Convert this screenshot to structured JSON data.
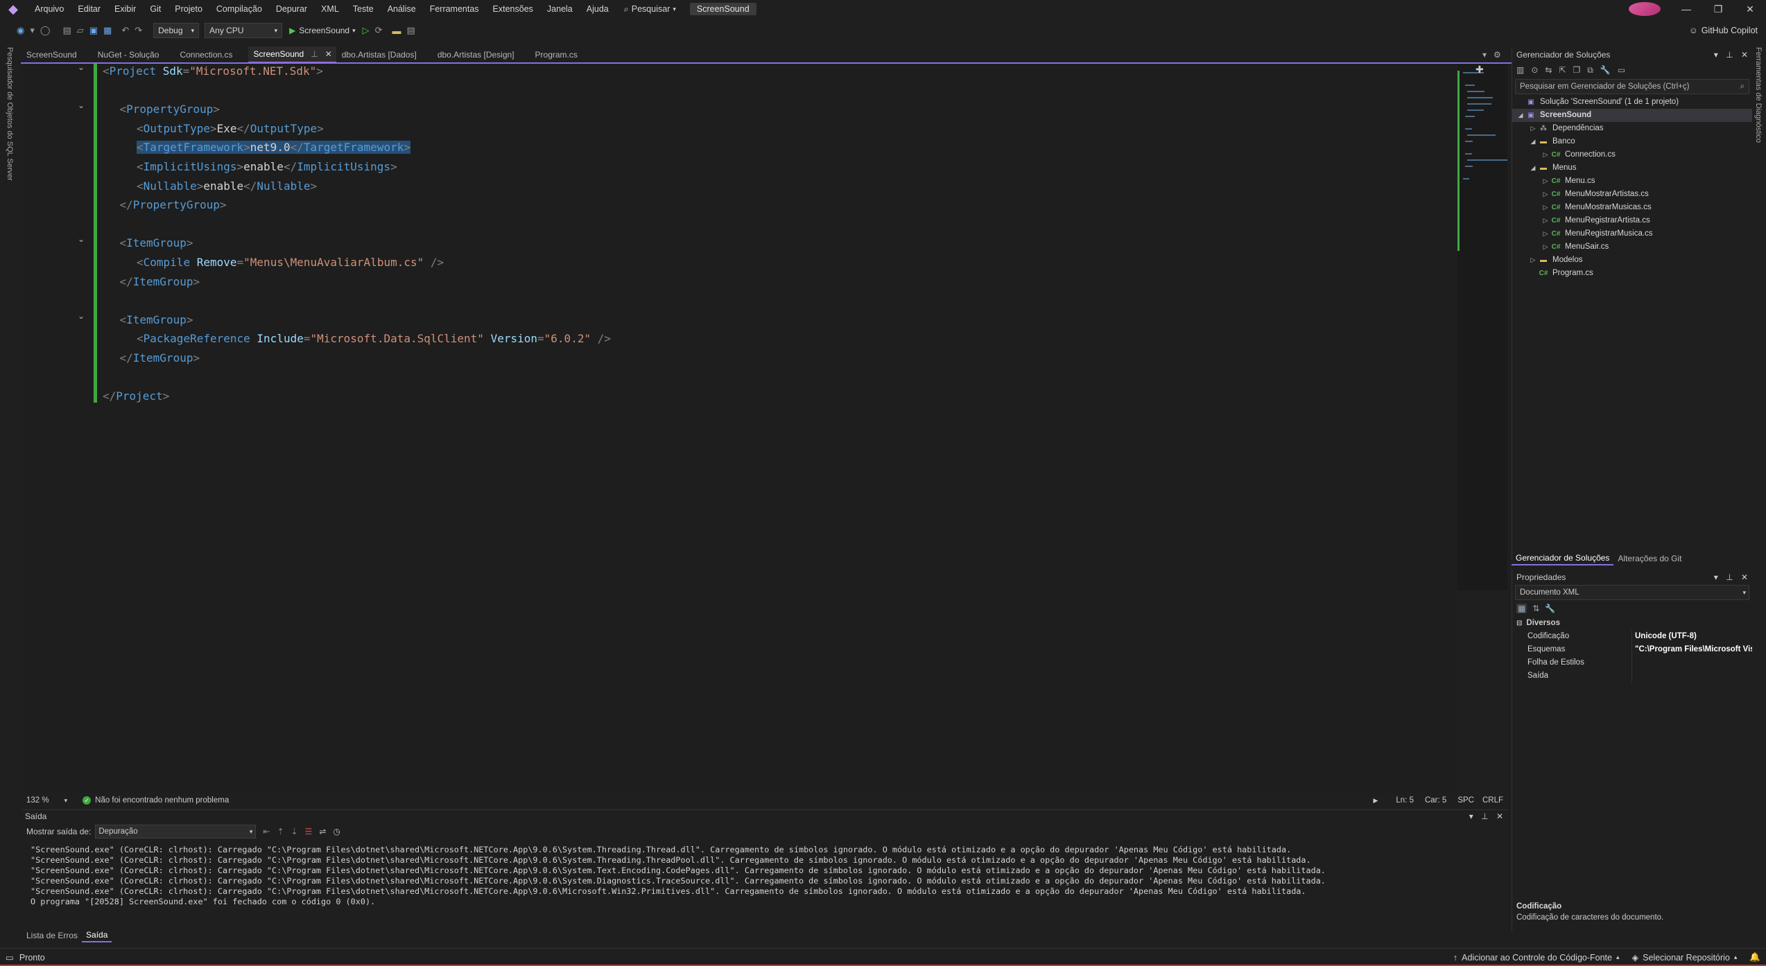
{
  "menubar": {
    "items": [
      "Arquivo",
      "Editar",
      "Exibir",
      "Git",
      "Projeto",
      "Compilação",
      "Depurar",
      "XML",
      "Teste",
      "Análise",
      "Ferramentas",
      "Extensões",
      "Janela",
      "Ajuda"
    ],
    "search_label": "Pesquisar",
    "project_badge": "ScreenSound"
  },
  "toolbar": {
    "config": "Debug",
    "platform": "Any CPU",
    "run_target": "ScreenSound",
    "copilot_label": "GitHub Copilot"
  },
  "side_labels": {
    "left": "Pesquisador de Objetos do SQL Server",
    "right": "Ferramentas de Diagnóstico"
  },
  "tabs": [
    {
      "label": "ScreenSound",
      "active": false
    },
    {
      "label": "NuGet - Solução",
      "active": false
    },
    {
      "label": "Connection.cs",
      "active": false
    },
    {
      "label": "ScreenSound",
      "active": true
    },
    {
      "label": "dbo.Artistas [Dados]",
      "active": false
    },
    {
      "label": "dbo.Artistas [Design]",
      "active": false
    },
    {
      "label": "Program.cs",
      "active": false
    }
  ],
  "editor": {
    "lines": [
      {
        "indent": 0,
        "fold": true,
        "tokens": [
          [
            "b",
            "<"
          ],
          [
            "n",
            "Project"
          ],
          [
            "x",
            " "
          ],
          [
            "a",
            "Sdk"
          ],
          [
            "b",
            "="
          ],
          [
            "s",
            "\"Microsoft.NET.Sdk\""
          ],
          [
            "b",
            ">"
          ]
        ]
      },
      {
        "indent": 0,
        "fold": false,
        "tokens": []
      },
      {
        "indent": 1,
        "fold": true,
        "tokens": [
          [
            "b",
            "<"
          ],
          [
            "n",
            "PropertyGroup"
          ],
          [
            "b",
            ">"
          ]
        ]
      },
      {
        "indent": 2,
        "fold": false,
        "tokens": [
          [
            "b",
            "<"
          ],
          [
            "n",
            "OutputType"
          ],
          [
            "b",
            ">"
          ],
          [
            "x",
            "Exe"
          ],
          [
            "b",
            "</"
          ],
          [
            "n",
            "OutputType"
          ],
          [
            "b",
            ">"
          ]
        ]
      },
      {
        "indent": 2,
        "fold": false,
        "highlight": true,
        "tokens": [
          [
            "b",
            "<"
          ],
          [
            "n",
            "TargetFramework"
          ],
          [
            "b",
            ">"
          ],
          [
            "x",
            "net9.0"
          ],
          [
            "b",
            "</"
          ],
          [
            "n",
            "TargetFramework"
          ],
          [
            "b",
            ">"
          ]
        ]
      },
      {
        "indent": 2,
        "fold": false,
        "tokens": [
          [
            "b",
            "<"
          ],
          [
            "n",
            "ImplicitUsings"
          ],
          [
            "b",
            ">"
          ],
          [
            "x",
            "enable"
          ],
          [
            "b",
            "</"
          ],
          [
            "n",
            "ImplicitUsings"
          ],
          [
            "b",
            ">"
          ]
        ]
      },
      {
        "indent": 2,
        "fold": false,
        "tokens": [
          [
            "b",
            "<"
          ],
          [
            "n",
            "Nullable"
          ],
          [
            "b",
            ">"
          ],
          [
            "x",
            "enable"
          ],
          [
            "b",
            "</"
          ],
          [
            "n",
            "Nullable"
          ],
          [
            "b",
            ">"
          ]
        ]
      },
      {
        "indent": 1,
        "fold": false,
        "tokens": [
          [
            "b",
            "</"
          ],
          [
            "n",
            "PropertyGroup"
          ],
          [
            "b",
            ">"
          ]
        ]
      },
      {
        "indent": 0,
        "fold": false,
        "tokens": []
      },
      {
        "indent": 1,
        "fold": true,
        "tokens": [
          [
            "b",
            "<"
          ],
          [
            "n",
            "ItemGroup"
          ],
          [
            "b",
            ">"
          ]
        ]
      },
      {
        "indent": 2,
        "fold": false,
        "tokens": [
          [
            "b",
            "<"
          ],
          [
            "n",
            "Compile"
          ],
          [
            "x",
            " "
          ],
          [
            "a",
            "Remove"
          ],
          [
            "b",
            "="
          ],
          [
            "s",
            "\"Menus\\MenuAvaliarAlbum.cs\""
          ],
          [
            "x",
            " "
          ],
          [
            "b",
            "/>"
          ]
        ]
      },
      {
        "indent": 1,
        "fold": false,
        "tokens": [
          [
            "b",
            "</"
          ],
          [
            "n",
            "ItemGroup"
          ],
          [
            "b",
            ">"
          ]
        ]
      },
      {
        "indent": 0,
        "fold": false,
        "tokens": []
      },
      {
        "indent": 1,
        "fold": true,
        "tokens": [
          [
            "b",
            "<"
          ],
          [
            "n",
            "ItemGroup"
          ],
          [
            "b",
            ">"
          ]
        ]
      },
      {
        "indent": 2,
        "fold": false,
        "tokens": [
          [
            "b",
            "<"
          ],
          [
            "n",
            "PackageReference"
          ],
          [
            "x",
            " "
          ],
          [
            "a",
            "Include"
          ],
          [
            "b",
            "="
          ],
          [
            "s",
            "\"Microsoft.Data.SqlClient\""
          ],
          [
            "x",
            " "
          ],
          [
            "a",
            "Version"
          ],
          [
            "b",
            "="
          ],
          [
            "s",
            "\"6.0.2\""
          ],
          [
            "x",
            " "
          ],
          [
            "b",
            "/>"
          ]
        ]
      },
      {
        "indent": 1,
        "fold": false,
        "tokens": [
          [
            "b",
            "</"
          ],
          [
            "n",
            "ItemGroup"
          ],
          [
            "b",
            ">"
          ]
        ]
      },
      {
        "indent": 0,
        "fold": false,
        "tokens": []
      },
      {
        "indent": 0,
        "fold": false,
        "tokens": [
          [
            "b",
            "</"
          ],
          [
            "n",
            "Project"
          ],
          [
            "b",
            ">"
          ]
        ]
      }
    ]
  },
  "editor_status": {
    "zoom": "132 %",
    "issues": "Não foi encontrado nenhum problema",
    "line": "Ln: 5",
    "col": "Car: 5",
    "spc": "SPC",
    "eol": "CRLF"
  },
  "solution_explorer": {
    "title": "Gerenciador de Soluções",
    "search_placeholder": "Pesquisar em Gerenciador de Soluções (Ctrl+ç)",
    "tree": [
      {
        "level": 0,
        "exp": "",
        "icon": "solution-icon",
        "glyph": "▣",
        "cls": "sln",
        "label": "Solução 'ScreenSound' (1 de 1 projeto)"
      },
      {
        "level": 0,
        "exp": "◢",
        "icon": "project-icon",
        "glyph": "▣",
        "cls": "sln",
        "label": "ScreenSound",
        "selected": true
      },
      {
        "level": 1,
        "exp": "▷",
        "icon": "dependencies-icon",
        "glyph": "⁂",
        "cls": "dep",
        "label": "Dependências"
      },
      {
        "level": 1,
        "exp": "◢",
        "icon": "folder-icon",
        "glyph": "▬",
        "cls": "folder",
        "label": "Banco"
      },
      {
        "level": 2,
        "exp": "▷",
        "icon": "csharp-file-icon",
        "glyph": "C#",
        "cls": "cs",
        "label": "Connection.cs"
      },
      {
        "level": 1,
        "exp": "◢",
        "icon": "folder-icon",
        "glyph": "▬",
        "cls": "folder",
        "label": "Menus"
      },
      {
        "level": 2,
        "exp": "▷",
        "icon": "csharp-file-icon",
        "glyph": "C#",
        "cls": "cs",
        "label": "Menu.cs"
      },
      {
        "level": 2,
        "exp": "▷",
        "icon": "csharp-file-icon",
        "glyph": "C#",
        "cls": "cs",
        "label": "MenuMostrarArtistas.cs"
      },
      {
        "level": 2,
        "exp": "▷",
        "icon": "csharp-file-icon",
        "glyph": "C#",
        "cls": "cs",
        "label": "MenuMostrarMusicas.cs"
      },
      {
        "level": 2,
        "exp": "▷",
        "icon": "csharp-file-icon",
        "glyph": "C#",
        "cls": "cs",
        "label": "MenuRegistrarArtista.cs"
      },
      {
        "level": 2,
        "exp": "▷",
        "icon": "csharp-file-icon",
        "glyph": "C#",
        "cls": "cs",
        "label": "MenuRegistrarMusica.cs"
      },
      {
        "level": 2,
        "exp": "▷",
        "icon": "csharp-file-icon",
        "glyph": "C#",
        "cls": "cs",
        "label": "MenuSair.cs"
      },
      {
        "level": 1,
        "exp": "▷",
        "icon": "folder-icon",
        "glyph": "▬",
        "cls": "folder",
        "label": "Modelos"
      },
      {
        "level": 1,
        "exp": "",
        "icon": "csharp-file-icon",
        "glyph": "C#",
        "cls": "cs",
        "label": "Program.cs"
      }
    ],
    "bottom_tabs": [
      "Gerenciador de Soluções",
      "Alterações do Git"
    ]
  },
  "properties": {
    "title": "Propriedades",
    "object": "Documento XML",
    "category": "Diversos",
    "rows": [
      {
        "key": "Codificação",
        "value": "Unicode (UTF-8)"
      },
      {
        "key": "Esquemas",
        "value": "\"C:\\Program Files\\Microsoft Vis"
      },
      {
        "key": "Folha de Estilos",
        "value": ""
      },
      {
        "key": "Saída",
        "value": ""
      }
    ],
    "desc_title": "Codificação",
    "desc_text": "Codificação de caracteres do documento."
  },
  "output": {
    "title": "Saída",
    "show_from_label": "Mostrar saída de:",
    "source": "Depuração",
    "lines": [
      "\"ScreenSound.exe\" (CoreCLR: clrhost): Carregado \"C:\\Program Files\\dotnet\\shared\\Microsoft.NETCore.App\\9.0.6\\System.Threading.Thread.dll\". Carregamento de símbolos ignorado. O módulo está otimizado e a opção do depurador 'Apenas Meu Código' está habilitada.",
      "\"ScreenSound.exe\" (CoreCLR: clrhost): Carregado \"C:\\Program Files\\dotnet\\shared\\Microsoft.NETCore.App\\9.0.6\\System.Threading.ThreadPool.dll\". Carregamento de símbolos ignorado. O módulo está otimizado e a opção do depurador 'Apenas Meu Código' está habilitada.",
      "\"ScreenSound.exe\" (CoreCLR: clrhost): Carregado \"C:\\Program Files\\dotnet\\shared\\Microsoft.NETCore.App\\9.0.6\\System.Text.Encoding.CodePages.dll\". Carregamento de símbolos ignorado. O módulo está otimizado e a opção do depurador 'Apenas Meu Código' está habilitada.",
      "\"ScreenSound.exe\" (CoreCLR: clrhost): Carregado \"C:\\Program Files\\dotnet\\shared\\Microsoft.NETCore.App\\9.0.6\\System.Diagnostics.TraceSource.dll\". Carregamento de símbolos ignorado. O módulo está otimizado e a opção do depurador 'Apenas Meu Código' está habilitada.",
      "\"ScreenSound.exe\" (CoreCLR: clrhost): Carregado \"C:\\Program Files\\dotnet\\shared\\Microsoft.NETCore.App\\9.0.6\\Microsoft.Win32.Primitives.dll\". Carregamento de símbolos ignorado. O módulo está otimizado e a opção do depurador 'Apenas Meu Código' está habilitada.",
      "O programa \"[20528] ScreenSound.exe\" foi fechado com o código 0 (0x0)."
    ],
    "tabs": [
      "Lista de Erros",
      "Saída"
    ]
  },
  "statusbar": {
    "ready": "Pronto",
    "source_control": "Adicionar ao Controle do Código-Fonte",
    "repo": "Selecionar Repositório"
  }
}
